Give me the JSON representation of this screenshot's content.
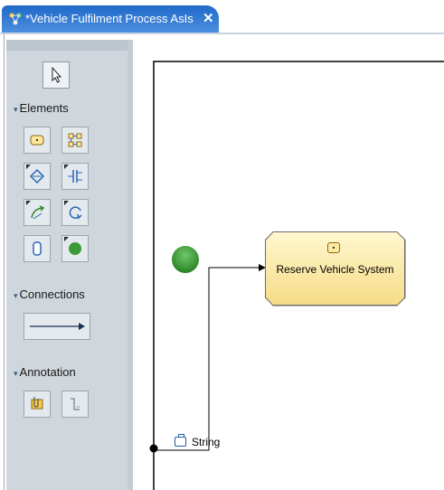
{
  "tab": {
    "title": "*Vehicle Fulfilment Process AsIs",
    "close_glyph": "✕",
    "icon": "process-icon"
  },
  "palette": {
    "select_tool": "pointer-icon",
    "elements_label": "Elements",
    "connections_label": "Connections",
    "annotation_label": "Annotation",
    "drawer_arrow": "▾"
  },
  "canvas": {
    "task_label": "Reserve Vehicle System",
    "string_label": "String",
    "start_event_color": "#3a9a37"
  }
}
